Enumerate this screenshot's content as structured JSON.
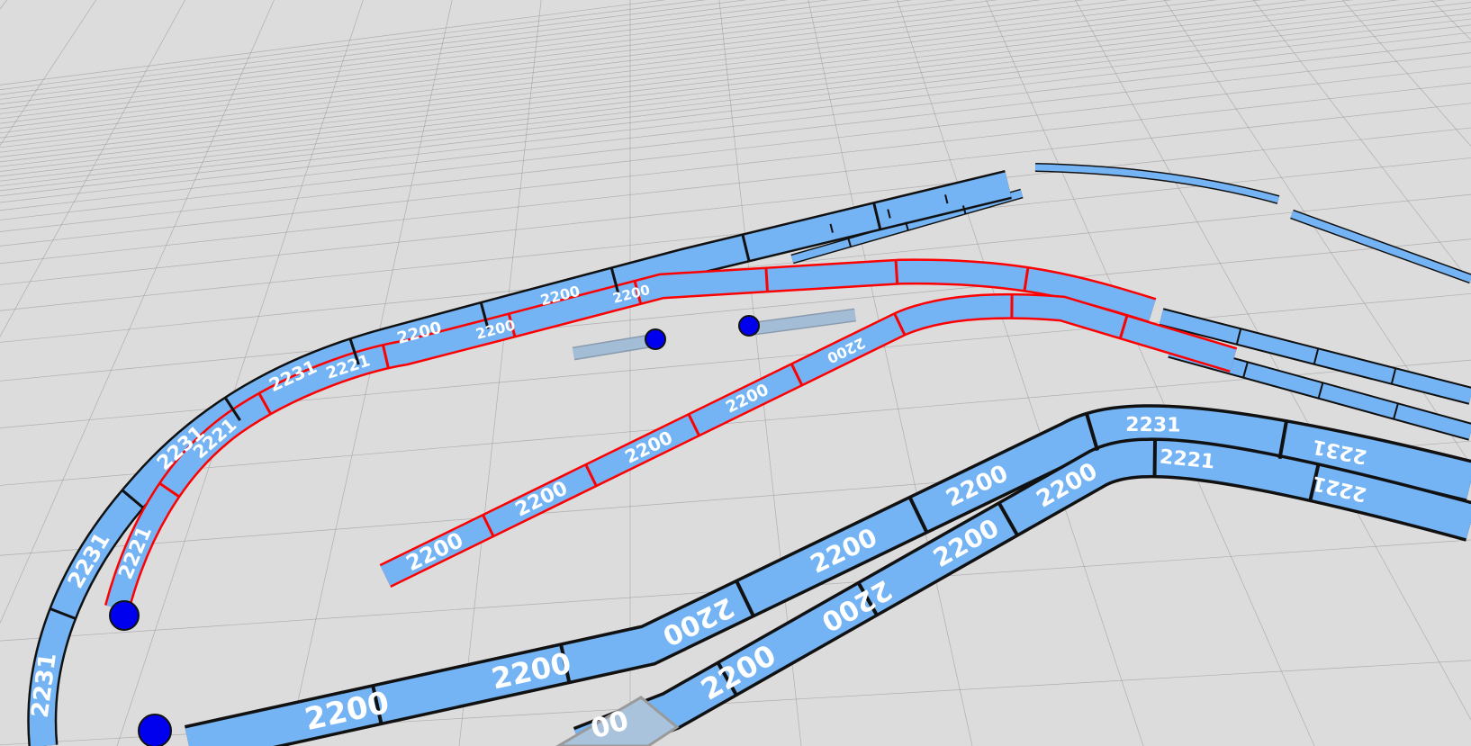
{
  "app": {
    "view": "3D track layout editor viewport"
  },
  "colors": {
    "ground": "#dcdcdc",
    "grid_line": "#8a8a8a",
    "track_fill": "#74b3f4",
    "track_outline": "#111111",
    "track_selected_outline": "#ff0000",
    "track_ghost_fill": "#a9c3dd",
    "endpoint_marker": "#0000ee",
    "label_text": "#ffffff"
  },
  "icons": {
    "endpoint": "circle-marker"
  },
  "track_codes": {
    "straight": "2200",
    "curve_inner": "2221",
    "curve_outer": "2231",
    "partial": "00"
  },
  "track_pieces": [
    {
      "name": "outer-curve-left-1",
      "code": "2231",
      "selected": false
    },
    {
      "name": "outer-curve-left-2",
      "code": "2231",
      "selected": false
    },
    {
      "name": "outer-curve-left-3",
      "code": "2231",
      "selected": false
    },
    {
      "name": "outer-curve-left-4",
      "code": "2231",
      "selected": false
    },
    {
      "name": "outer-top-straight-1",
      "code": "2200",
      "selected": false
    },
    {
      "name": "outer-top-straight-2",
      "code": "2200",
      "selected": false
    },
    {
      "name": "selected-curve-1",
      "code": "2221",
      "selected": true
    },
    {
      "name": "selected-curve-2",
      "code": "2221",
      "selected": true
    },
    {
      "name": "selected-curve-3",
      "code": "2221",
      "selected": true
    },
    {
      "name": "selected-top-straight-1",
      "code": "2200",
      "selected": true
    },
    {
      "name": "selected-top-straight-2",
      "code": "2200",
      "selected": true
    },
    {
      "name": "selected-diagonal-1",
      "code": "2200",
      "selected": true
    },
    {
      "name": "selected-diagonal-2",
      "code": "2200",
      "selected": true
    },
    {
      "name": "selected-diagonal-3",
      "code": "2200",
      "selected": true
    },
    {
      "name": "selected-diagonal-4",
      "code": "2200",
      "selected": true
    },
    {
      "name": "selected-diagonal-5",
      "code": "2200",
      "selected": true
    },
    {
      "name": "front-outer-straight-1",
      "code": "2200",
      "selected": false
    },
    {
      "name": "front-outer-straight-2",
      "code": "2200",
      "selected": false
    },
    {
      "name": "front-outer-straight-3",
      "code": "2200",
      "selected": false
    },
    {
      "name": "front-outer-straight-4",
      "code": "2200",
      "selected": false
    },
    {
      "name": "front-outer-straight-5",
      "code": "2200",
      "selected": false
    },
    {
      "name": "front-inner-straight-1",
      "code": "2200",
      "selected": false
    },
    {
      "name": "front-inner-straight-2",
      "code": "2200",
      "selected": false
    },
    {
      "name": "front-inner-straight-3",
      "code": "2200",
      "selected": false
    },
    {
      "name": "front-inner-straight-4",
      "code": "2200",
      "selected": false
    },
    {
      "name": "right-outer-curve-1",
      "code": "2231",
      "selected": false
    },
    {
      "name": "right-outer-curve-2",
      "code": "2231",
      "selected": false
    },
    {
      "name": "right-inner-curve-1",
      "code": "2221",
      "selected": false
    },
    {
      "name": "right-inner-curve-2",
      "code": "2221",
      "selected": false
    },
    {
      "name": "ghost-front-piece",
      "code": "00",
      "selected": false
    }
  ]
}
